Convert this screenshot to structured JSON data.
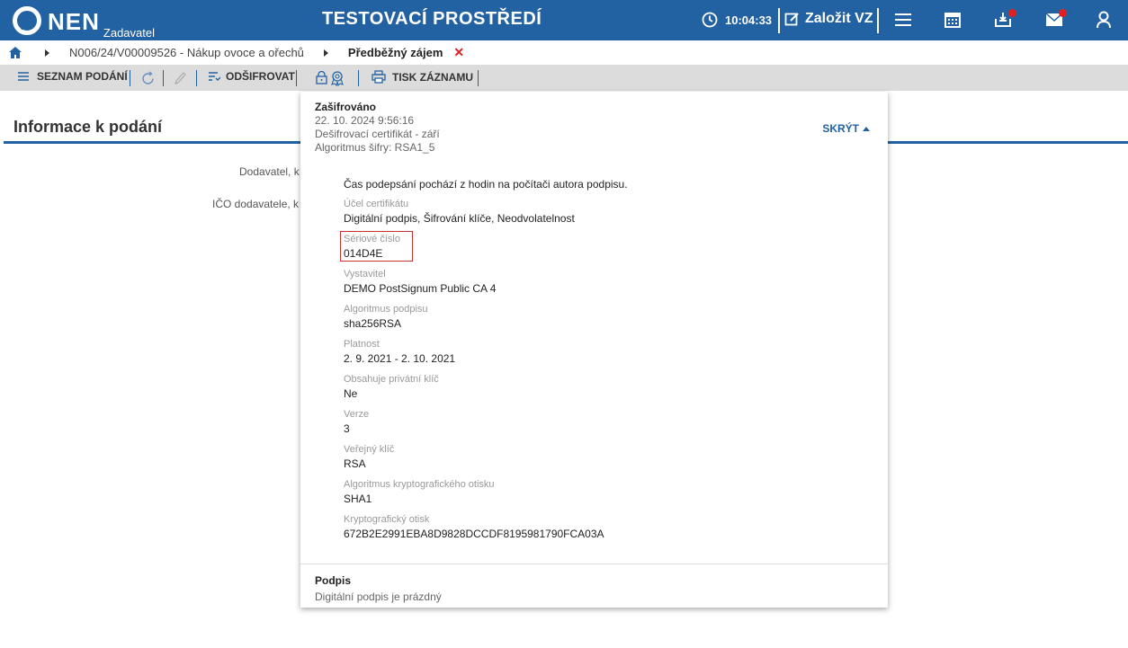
{
  "header": {
    "logo_text": "NEN",
    "logo_sub": "Zadavatel",
    "env_title": "TESTOVACÍ PROSTŘEDÍ",
    "clock": "10:04:33",
    "create_label": "Založit VZ"
  },
  "breadcrumb": {
    "item1": "N006/24/V00009526 - Nákup ovoce a ořechů",
    "item2": "Předběžný zájem",
    "close_glyph": "✕"
  },
  "toolbar": {
    "list_label": "SEZNAM PODÁNÍ",
    "decrypt_label": "ODŠIFROVAT",
    "print_label": "TISK ZÁZNAMU"
  },
  "section": {
    "title": "Informace k podání",
    "label1": "Dodavatel, k",
    "label2": "IČO dodavatele, k"
  },
  "popup": {
    "status": "Zašifrováno",
    "date": "22. 10. 2024 9:56:16",
    "cert": "Dešifrovací certifikát - září",
    "algo": "Algoritmus šifry: RSA1_5",
    "hide_label": "SKRÝT",
    "note": "Čas podepsání pochází z hodin na počítači autora podpisu.",
    "fields": [
      {
        "label": "Účel certifikátu",
        "value": "Digitální podpis, Šifrování klíče, Neodvolatelnost"
      },
      {
        "label": "Sériové číslo",
        "value": "014D4E"
      },
      {
        "label": "Vystavitel",
        "value": "DEMO PostSignum Public CA 4"
      },
      {
        "label": "Algoritmus podpisu",
        "value": "sha256RSA"
      },
      {
        "label": "Platnost",
        "value": "2. 9. 2021 - 2. 10. 2021"
      },
      {
        "label": "Obsahuje privátní klíč",
        "value": "Ne"
      },
      {
        "label": "Verze",
        "value": "3"
      },
      {
        "label": "Veřejný klíč",
        "value": "RSA"
      },
      {
        "label": "Algoritmus kryptografického otisku",
        "value": "SHA1"
      },
      {
        "label": "Kryptografický otisk",
        "value": "672B2E2991EBA8D9828DCCDF8195981790FCA03A"
      }
    ],
    "sign_title": "Podpis",
    "sign_value": "Digitální podpis je prázdný"
  },
  "colors": {
    "brand": "#2362a2",
    "alert": "#e02020"
  }
}
